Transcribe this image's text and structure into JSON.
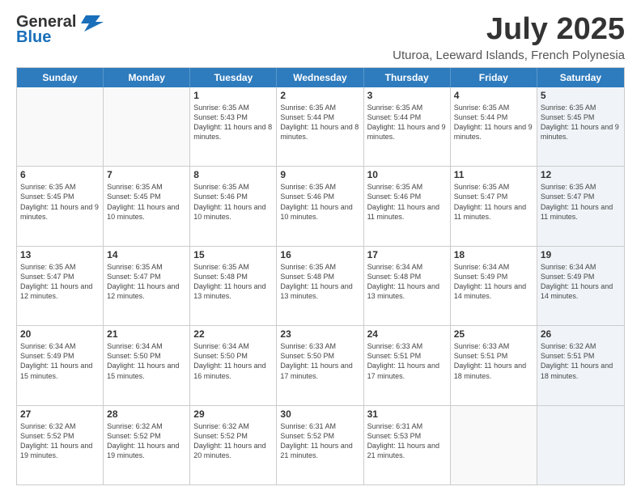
{
  "header": {
    "logo_general": "General",
    "logo_blue": "Blue",
    "month_title": "July 2025",
    "subtitle": "Uturoa, Leeward Islands, French Polynesia"
  },
  "days_of_week": [
    "Sunday",
    "Monday",
    "Tuesday",
    "Wednesday",
    "Thursday",
    "Friday",
    "Saturday"
  ],
  "weeks": [
    [
      {
        "day": "",
        "info": "",
        "shaded": false,
        "empty": true
      },
      {
        "day": "",
        "info": "",
        "shaded": false,
        "empty": true
      },
      {
        "day": "1",
        "info": "Sunrise: 6:35 AM\nSunset: 5:43 PM\nDaylight: 11 hours and 8 minutes.",
        "shaded": false,
        "empty": false
      },
      {
        "day": "2",
        "info": "Sunrise: 6:35 AM\nSunset: 5:44 PM\nDaylight: 11 hours and 8 minutes.",
        "shaded": false,
        "empty": false
      },
      {
        "day": "3",
        "info": "Sunrise: 6:35 AM\nSunset: 5:44 PM\nDaylight: 11 hours and 9 minutes.",
        "shaded": false,
        "empty": false
      },
      {
        "day": "4",
        "info": "Sunrise: 6:35 AM\nSunset: 5:44 PM\nDaylight: 11 hours and 9 minutes.",
        "shaded": false,
        "empty": false
      },
      {
        "day": "5",
        "info": "Sunrise: 6:35 AM\nSunset: 5:45 PM\nDaylight: 11 hours and 9 minutes.",
        "shaded": true,
        "empty": false
      }
    ],
    [
      {
        "day": "6",
        "info": "Sunrise: 6:35 AM\nSunset: 5:45 PM\nDaylight: 11 hours and 9 minutes.",
        "shaded": false,
        "empty": false
      },
      {
        "day": "7",
        "info": "Sunrise: 6:35 AM\nSunset: 5:45 PM\nDaylight: 11 hours and 10 minutes.",
        "shaded": false,
        "empty": false
      },
      {
        "day": "8",
        "info": "Sunrise: 6:35 AM\nSunset: 5:46 PM\nDaylight: 11 hours and 10 minutes.",
        "shaded": false,
        "empty": false
      },
      {
        "day": "9",
        "info": "Sunrise: 6:35 AM\nSunset: 5:46 PM\nDaylight: 11 hours and 10 minutes.",
        "shaded": false,
        "empty": false
      },
      {
        "day": "10",
        "info": "Sunrise: 6:35 AM\nSunset: 5:46 PM\nDaylight: 11 hours and 11 minutes.",
        "shaded": false,
        "empty": false
      },
      {
        "day": "11",
        "info": "Sunrise: 6:35 AM\nSunset: 5:47 PM\nDaylight: 11 hours and 11 minutes.",
        "shaded": false,
        "empty": false
      },
      {
        "day": "12",
        "info": "Sunrise: 6:35 AM\nSunset: 5:47 PM\nDaylight: 11 hours and 11 minutes.",
        "shaded": true,
        "empty": false
      }
    ],
    [
      {
        "day": "13",
        "info": "Sunrise: 6:35 AM\nSunset: 5:47 PM\nDaylight: 11 hours and 12 minutes.",
        "shaded": false,
        "empty": false
      },
      {
        "day": "14",
        "info": "Sunrise: 6:35 AM\nSunset: 5:47 PM\nDaylight: 11 hours and 12 minutes.",
        "shaded": false,
        "empty": false
      },
      {
        "day": "15",
        "info": "Sunrise: 6:35 AM\nSunset: 5:48 PM\nDaylight: 11 hours and 13 minutes.",
        "shaded": false,
        "empty": false
      },
      {
        "day": "16",
        "info": "Sunrise: 6:35 AM\nSunset: 5:48 PM\nDaylight: 11 hours and 13 minutes.",
        "shaded": false,
        "empty": false
      },
      {
        "day": "17",
        "info": "Sunrise: 6:34 AM\nSunset: 5:48 PM\nDaylight: 11 hours and 13 minutes.",
        "shaded": false,
        "empty": false
      },
      {
        "day": "18",
        "info": "Sunrise: 6:34 AM\nSunset: 5:49 PM\nDaylight: 11 hours and 14 minutes.",
        "shaded": false,
        "empty": false
      },
      {
        "day": "19",
        "info": "Sunrise: 6:34 AM\nSunset: 5:49 PM\nDaylight: 11 hours and 14 minutes.",
        "shaded": true,
        "empty": false
      }
    ],
    [
      {
        "day": "20",
        "info": "Sunrise: 6:34 AM\nSunset: 5:49 PM\nDaylight: 11 hours and 15 minutes.",
        "shaded": false,
        "empty": false
      },
      {
        "day": "21",
        "info": "Sunrise: 6:34 AM\nSunset: 5:50 PM\nDaylight: 11 hours and 15 minutes.",
        "shaded": false,
        "empty": false
      },
      {
        "day": "22",
        "info": "Sunrise: 6:34 AM\nSunset: 5:50 PM\nDaylight: 11 hours and 16 minutes.",
        "shaded": false,
        "empty": false
      },
      {
        "day": "23",
        "info": "Sunrise: 6:33 AM\nSunset: 5:50 PM\nDaylight: 11 hours and 17 minutes.",
        "shaded": false,
        "empty": false
      },
      {
        "day": "24",
        "info": "Sunrise: 6:33 AM\nSunset: 5:51 PM\nDaylight: 11 hours and 17 minutes.",
        "shaded": false,
        "empty": false
      },
      {
        "day": "25",
        "info": "Sunrise: 6:33 AM\nSunset: 5:51 PM\nDaylight: 11 hours and 18 minutes.",
        "shaded": false,
        "empty": false
      },
      {
        "day": "26",
        "info": "Sunrise: 6:32 AM\nSunset: 5:51 PM\nDaylight: 11 hours and 18 minutes.",
        "shaded": true,
        "empty": false
      }
    ],
    [
      {
        "day": "27",
        "info": "Sunrise: 6:32 AM\nSunset: 5:52 PM\nDaylight: 11 hours and 19 minutes.",
        "shaded": false,
        "empty": false
      },
      {
        "day": "28",
        "info": "Sunrise: 6:32 AM\nSunset: 5:52 PM\nDaylight: 11 hours and 19 minutes.",
        "shaded": false,
        "empty": false
      },
      {
        "day": "29",
        "info": "Sunrise: 6:32 AM\nSunset: 5:52 PM\nDaylight: 11 hours and 20 minutes.",
        "shaded": false,
        "empty": false
      },
      {
        "day": "30",
        "info": "Sunrise: 6:31 AM\nSunset: 5:52 PM\nDaylight: 11 hours and 21 minutes.",
        "shaded": false,
        "empty": false
      },
      {
        "day": "31",
        "info": "Sunrise: 6:31 AM\nSunset: 5:53 PM\nDaylight: 11 hours and 21 minutes.",
        "shaded": false,
        "empty": false
      },
      {
        "day": "",
        "info": "",
        "shaded": false,
        "empty": true
      },
      {
        "day": "",
        "info": "",
        "shaded": true,
        "empty": true
      }
    ]
  ]
}
